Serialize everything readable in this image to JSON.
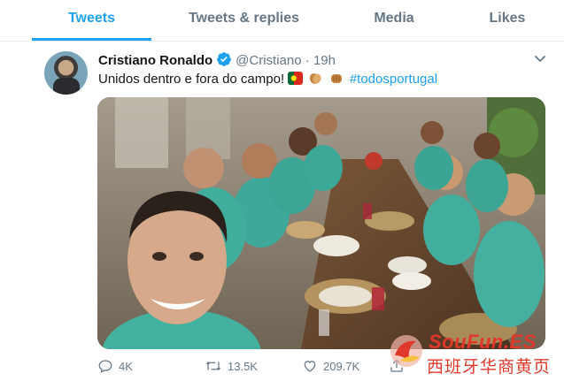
{
  "tabs": [
    {
      "label": "Tweets",
      "active": true
    },
    {
      "label": "Tweets & replies",
      "active": false
    },
    {
      "label": "Media",
      "active": false
    },
    {
      "label": "Likes",
      "active": false
    }
  ],
  "tweet": {
    "author_name": "Cristiano Ronaldo",
    "handle": "@Cristiano",
    "separator": "·",
    "time": "19h",
    "text": "Unidos dentro e fora do campo!",
    "hashtag": "#todosportugal",
    "emoji_icons": [
      "portugal-flag-icon",
      "clapping-hands-icon",
      "fist-bump-icon"
    ],
    "photo": "team-dinner-selfie"
  },
  "actions": {
    "replies": "4K",
    "retweets": "13.5K",
    "likes": "209.7K"
  },
  "watermark": {
    "brand": "SouFun.ES",
    "subtitle": "西班牙华商黄页"
  },
  "colors": {
    "accent": "#1da1f2",
    "muted": "#657786",
    "text": "#14171a",
    "watermark": "#e0382a"
  }
}
